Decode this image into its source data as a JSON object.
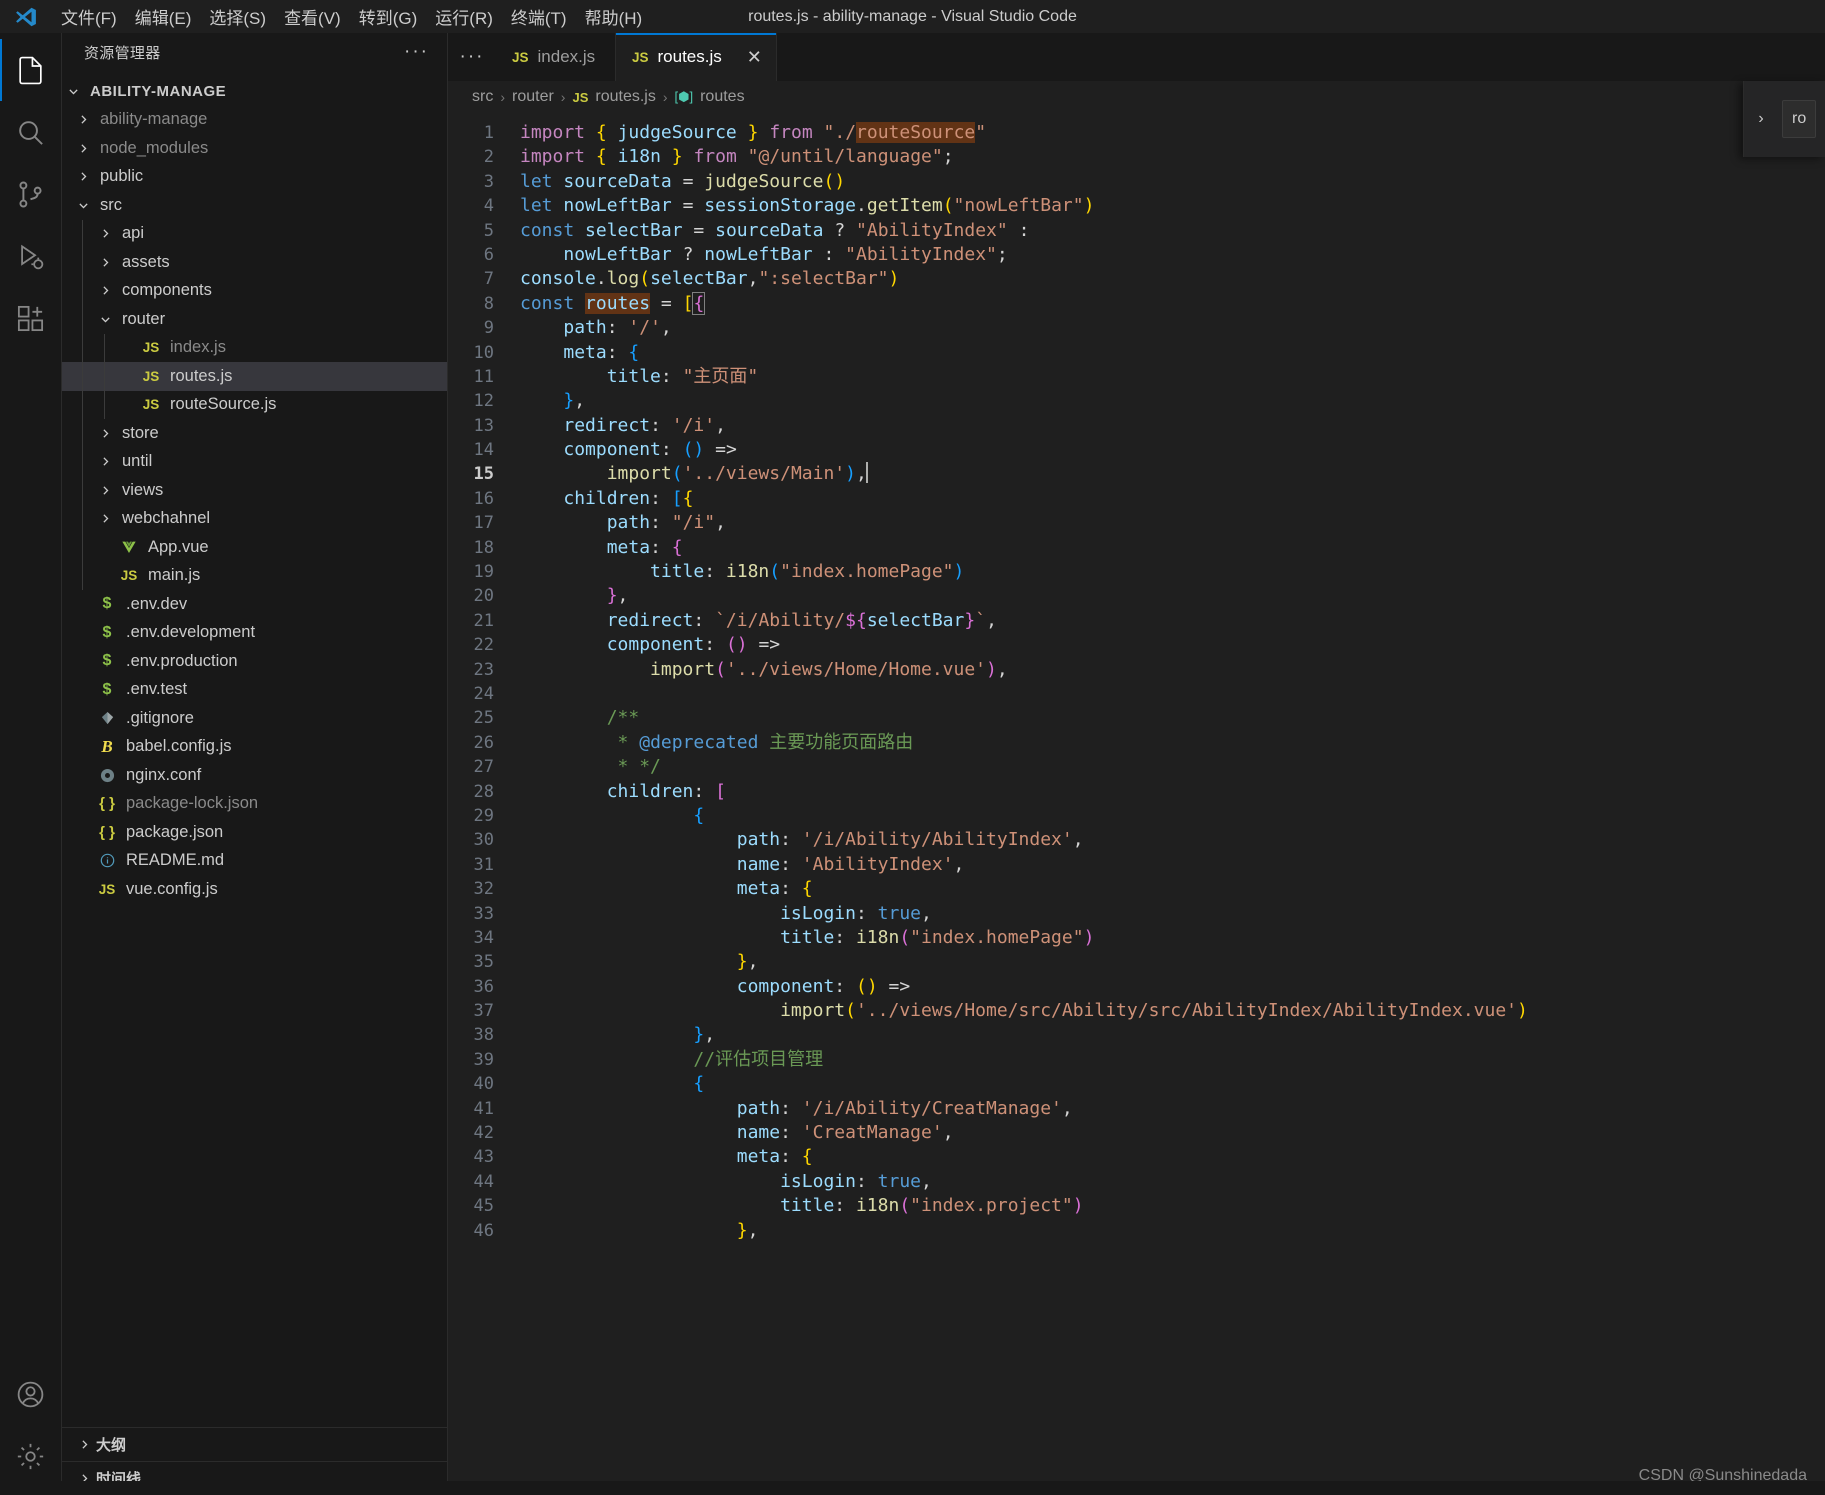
{
  "window": {
    "title": "routes.js - ability-manage - Visual Studio Code",
    "logo_icon": "vscode-logo"
  },
  "menubar": {
    "items": [
      {
        "label": "文件(F)",
        "name": "menu-file"
      },
      {
        "label": "编辑(E)",
        "name": "menu-edit"
      },
      {
        "label": "选择(S)",
        "name": "menu-selection"
      },
      {
        "label": "查看(V)",
        "name": "menu-view"
      },
      {
        "label": "转到(G)",
        "name": "menu-go"
      },
      {
        "label": "运行(R)",
        "name": "menu-run"
      },
      {
        "label": "终端(T)",
        "name": "menu-terminal"
      },
      {
        "label": "帮助(H)",
        "name": "menu-help"
      }
    ]
  },
  "activitybar": {
    "items": [
      {
        "icon": "files-explorer-icon",
        "active": true
      },
      {
        "icon": "search-icon",
        "active": false
      },
      {
        "icon": "source-control-icon",
        "active": false
      },
      {
        "icon": "run-and-debug-icon",
        "active": false
      },
      {
        "icon": "extensions-icon",
        "active": false
      }
    ],
    "bottom": [
      {
        "icon": "accounts-icon"
      },
      {
        "icon": "settings-gear-icon"
      }
    ]
  },
  "sidebar": {
    "header_title": "资源管理器",
    "more_actions": "···",
    "root_label": "ABILITY-MANAGE",
    "tree": [
      {
        "label": "ability-manage",
        "depth": 1,
        "type": "folder",
        "expanded": false,
        "dim": true
      },
      {
        "label": "node_modules",
        "depth": 1,
        "type": "folder",
        "expanded": false,
        "dim": true
      },
      {
        "label": "public",
        "depth": 1,
        "type": "folder",
        "expanded": false,
        "dim": false
      },
      {
        "label": "src",
        "depth": 1,
        "type": "folder",
        "expanded": true,
        "dim": false
      },
      {
        "label": "api",
        "depth": 2,
        "type": "folder",
        "expanded": false,
        "dim": false
      },
      {
        "label": "assets",
        "depth": 2,
        "type": "folder",
        "expanded": false,
        "dim": false
      },
      {
        "label": "components",
        "depth": 2,
        "type": "folder",
        "expanded": false,
        "dim": false
      },
      {
        "label": "router",
        "depth": 2,
        "type": "folder",
        "expanded": true,
        "dim": false
      },
      {
        "label": "index.js",
        "depth": 3,
        "type": "js",
        "dim": true
      },
      {
        "label": "routes.js",
        "depth": 3,
        "type": "js",
        "selected": true,
        "dim": false
      },
      {
        "label": "routeSource.js",
        "depth": 3,
        "type": "js",
        "dim": false
      },
      {
        "label": "store",
        "depth": 2,
        "type": "folder",
        "expanded": false,
        "dim": false
      },
      {
        "label": "until",
        "depth": 2,
        "type": "folder",
        "expanded": false,
        "dim": false
      },
      {
        "label": "views",
        "depth": 2,
        "type": "folder",
        "expanded": false,
        "dim": false
      },
      {
        "label": "webchahnel",
        "depth": 2,
        "type": "folder",
        "expanded": false,
        "dim": false
      },
      {
        "label": "App.vue",
        "depth": 2,
        "type": "vue",
        "dim": false
      },
      {
        "label": "main.js",
        "depth": 2,
        "type": "js",
        "dim": false
      },
      {
        "label": ".env.dev",
        "depth": 1,
        "type": "env",
        "dim": false
      },
      {
        "label": ".env.development",
        "depth": 1,
        "type": "env",
        "dim": false
      },
      {
        "label": ".env.production",
        "depth": 1,
        "type": "env",
        "dim": false
      },
      {
        "label": ".env.test",
        "depth": 1,
        "type": "env",
        "dim": false
      },
      {
        "label": ".gitignore",
        "depth": 1,
        "type": "git",
        "dim": false
      },
      {
        "label": "babel.config.js",
        "depth": 1,
        "type": "babel",
        "dim": false
      },
      {
        "label": "nginx.conf",
        "depth": 1,
        "type": "conf",
        "dim": false
      },
      {
        "label": "package-lock.json",
        "depth": 1,
        "type": "json",
        "dim": true
      },
      {
        "label": "package.json",
        "depth": 1,
        "type": "json",
        "dim": false
      },
      {
        "label": "README.md",
        "depth": 1,
        "type": "md",
        "dim": false
      },
      {
        "label": "vue.config.js",
        "depth": 1,
        "type": "js",
        "dim": false
      }
    ],
    "sections": [
      {
        "label": "大纲",
        "name": "sidebar-section-outline"
      },
      {
        "label": "时间线",
        "name": "sidebar-section-timeline"
      }
    ]
  },
  "tabs": {
    "overflow_label": "···",
    "items": [
      {
        "label": "index.js",
        "badge": "JS",
        "active": false,
        "closable": false
      },
      {
        "label": "routes.js",
        "badge": "JS",
        "active": true,
        "closable": true,
        "close_glyph": "✕"
      }
    ]
  },
  "breadcrumb": {
    "separator": "›",
    "items": [
      {
        "label": "src",
        "kind": "folder"
      },
      {
        "label": "router",
        "kind": "folder"
      },
      {
        "label": "routes.js",
        "kind": "js"
      },
      {
        "label": "routes",
        "kind": "symbol"
      }
    ]
  },
  "right_peek": {
    "chevron": "›",
    "tab_label": "ro"
  },
  "watermark": "CSDN @Sunshinedada",
  "editor": {
    "language": "javascript",
    "cursor_line": 15,
    "highlighted_word": "routes",
    "first_line": 1,
    "last_line": 46,
    "lines": [
      {
        "n": 1,
        "html": "<span class=\"kw\">import</span> <span class=\"b1\">{</span> <span class=\"var\">judgeSource</span> <span class=\"b1\">}</span> <span class=\"kw\">from</span> <span class=\"str\">\"./</span><span class=\"str hl\">routeSource</span><span class=\"str\">\"</span>"
      },
      {
        "n": 2,
        "html": "<span class=\"kw\">import</span> <span class=\"b1\">{</span> <span class=\"var\">i18n</span> <span class=\"b1\">}</span> <span class=\"kw\">from</span> <span class=\"str\">\"@/until/language\"</span><span class=\"op\">;</span>"
      },
      {
        "n": 3,
        "html": "<span class=\"kw2\">let</span> <span class=\"var\">sourceData</span> <span class=\"op\">=</span> <span class=\"fn\">judgeSource</span><span class=\"b1\">()</span>"
      },
      {
        "n": 4,
        "html": "<span class=\"kw2\">let</span> <span class=\"var\">nowLeftBar</span> <span class=\"op\">=</span> <span class=\"var\">sessionStorage</span><span class=\"op\">.</span><span class=\"fn\">getItem</span><span class=\"b1\">(</span><span class=\"str\">\"nowLeftBar\"</span><span class=\"b1\">)</span>"
      },
      {
        "n": 5,
        "html": "<span class=\"kw2\">const</span> <span class=\"var\">selectBar</span> <span class=\"op\">=</span> <span class=\"var\">sourceData</span> <span class=\"op\">?</span> <span class=\"str\">\"AbilityIndex\"</span> <span class=\"op\">:</span>"
      },
      {
        "n": 6,
        "html": "    <span class=\"var\">nowLeftBar</span> <span class=\"op\">?</span> <span class=\"var\">nowLeftBar</span> <span class=\"op\">:</span> <span class=\"str\">\"AbilityIndex\"</span><span class=\"op\">;</span>"
      },
      {
        "n": 7,
        "html": "<span class=\"var\">console</span><span class=\"op\">.</span><span class=\"fn\">log</span><span class=\"b1\">(</span><span class=\"var\">selectBar</span><span class=\"op\">,</span><span class=\"str\">\":selectBar\"</span><span class=\"b1\">)</span>"
      },
      {
        "n": 8,
        "html": "<span class=\"kw2\">const</span> <span class=\"var hl\">routes</span> <span class=\"op\">=</span> <span class=\"b1\">[</span><span class=\"b2 hl-box\">{</span>"
      },
      {
        "n": 9,
        "html": "    <span class=\"var\">path</span><span class=\"op\">:</span> <span class=\"str\">'/'</span><span class=\"op\">,</span>"
      },
      {
        "n": 10,
        "html": "    <span class=\"var\">meta</span><span class=\"op\">:</span> <span class=\"b3\">{</span>"
      },
      {
        "n": 11,
        "html": "        <span class=\"var\">title</span><span class=\"op\">:</span> <span class=\"str\">\"主页面\"</span>"
      },
      {
        "n": 12,
        "html": "    <span class=\"b3\">}</span><span class=\"op\">,</span>"
      },
      {
        "n": 13,
        "html": "    <span class=\"var\">redirect</span><span class=\"op\">:</span> <span class=\"str\">'/i'</span><span class=\"op\">,</span>"
      },
      {
        "n": 14,
        "html": "    <span class=\"var\">component</span><span class=\"op\">:</span> <span class=\"b3\">()</span> <span class=\"op\">=&gt;</span>"
      },
      {
        "n": 15,
        "html": "        <span class=\"fn\">import</span><span class=\"b3\">(</span><span class=\"str\">'../views/Main'</span><span class=\"b3\">)</span><span class=\"op\">,</span><span class=\"cursor-bar\"></span>"
      },
      {
        "n": 16,
        "html": "    <span class=\"var\">children</span><span class=\"op\">:</span> <span class=\"b3\">[</span><span class=\"b1\">{</span>"
      },
      {
        "n": 17,
        "html": "        <span class=\"var\">path</span><span class=\"op\">:</span> <span class=\"str\">\"/i\"</span><span class=\"op\">,</span>"
      },
      {
        "n": 18,
        "html": "        <span class=\"var\">meta</span><span class=\"op\">:</span> <span class=\"b2\">{</span>"
      },
      {
        "n": 19,
        "html": "            <span class=\"var\">title</span><span class=\"op\">:</span> <span class=\"fn\">i18n</span><span class=\"b3\">(</span><span class=\"str\">\"index.homePage\"</span><span class=\"b3\">)</span>"
      },
      {
        "n": 20,
        "html": "        <span class=\"b2\">}</span><span class=\"op\">,</span>"
      },
      {
        "n": 21,
        "html": "        <span class=\"var\">redirect</span><span class=\"op\">:</span> <span class=\"str\">`/i/Ability/</span><span class=\"b2\">${</span><span class=\"var\">selectBar</span><span class=\"b2\">}</span><span class=\"str\">`</span><span class=\"op\">,</span>"
      },
      {
        "n": 22,
        "html": "        <span class=\"var\">component</span><span class=\"op\">:</span> <span class=\"b2\">()</span> <span class=\"op\">=&gt;</span>"
      },
      {
        "n": 23,
        "html": "            <span class=\"fn\">import</span><span class=\"b2\">(</span><span class=\"str\">'../views/Home/Home.vue'</span><span class=\"b2\">)</span><span class=\"op\">,</span>"
      },
      {
        "n": 24,
        "html": ""
      },
      {
        "n": 25,
        "html": "        <span class=\"cmt\">/**</span>"
      },
      {
        "n": 26,
        "html": "         <span class=\"cmt\">* </span><span class=\"cmt-tag\">@deprecated</span><span class=\"cmt\"> 主要功能页面路由</span>"
      },
      {
        "n": 27,
        "html": "         <span class=\"cmt\">* */</span>"
      },
      {
        "n": 28,
        "html": "        <span class=\"var\">children</span><span class=\"op\">:</span> <span class=\"b2\">[</span>"
      },
      {
        "n": 29,
        "html": "                <span class=\"b3\">{</span>"
      },
      {
        "n": 30,
        "html": "                    <span class=\"var\">path</span><span class=\"op\">:</span> <span class=\"str\">'/i/Ability/AbilityIndex'</span><span class=\"op\">,</span>"
      },
      {
        "n": 31,
        "html": "                    <span class=\"var\">name</span><span class=\"op\">:</span> <span class=\"str\">'AbilityIndex'</span><span class=\"op\">,</span>"
      },
      {
        "n": 32,
        "html": "                    <span class=\"var\">meta</span><span class=\"op\">:</span> <span class=\"b1\">{</span>"
      },
      {
        "n": 33,
        "html": "                        <span class=\"var\">isLogin</span><span class=\"op\">:</span> <span class=\"kw2\">true</span><span class=\"op\">,</span>"
      },
      {
        "n": 34,
        "html": "                        <span class=\"var\">title</span><span class=\"op\">:</span> <span class=\"fn\">i18n</span><span class=\"b2\">(</span><span class=\"str\">\"index.homePage\"</span><span class=\"b2\">)</span>"
      },
      {
        "n": 35,
        "html": "                    <span class=\"b1\">}</span><span class=\"op\">,</span>"
      },
      {
        "n": 36,
        "html": "                    <span class=\"var\">component</span><span class=\"op\">:</span> <span class=\"b1\">()</span> <span class=\"op\">=&gt;</span>"
      },
      {
        "n": 37,
        "html": "                        <span class=\"fn\">import</span><span class=\"b1\">(</span><span class=\"str\">'../views/Home/src/Ability/src/AbilityIndex/AbilityIndex.vue'</span><span class=\"b1\">)</span>"
      },
      {
        "n": 38,
        "html": "                <span class=\"b3\">}</span><span class=\"op\">,</span>"
      },
      {
        "n": 39,
        "html": "                <span class=\"cmt\">//评估项目管理</span>"
      },
      {
        "n": 40,
        "html": "                <span class=\"b3\">{</span>"
      },
      {
        "n": 41,
        "html": "                    <span class=\"var\">path</span><span class=\"op\">:</span> <span class=\"str\">'/i/Ability/CreatManage'</span><span class=\"op\">,</span>"
      },
      {
        "n": 42,
        "html": "                    <span class=\"var\">name</span><span class=\"op\">:</span> <span class=\"str\">'CreatManage'</span><span class=\"op\">,</span>"
      },
      {
        "n": 43,
        "html": "                    <span class=\"var\">meta</span><span class=\"op\">:</span> <span class=\"b1\">{</span>"
      },
      {
        "n": 44,
        "html": "                        <span class=\"var\">isLogin</span><span class=\"op\">:</span> <span class=\"kw2\">true</span><span class=\"op\">,</span>"
      },
      {
        "n": 45,
        "html": "                        <span class=\"var\">title</span><span class=\"op\">:</span> <span class=\"fn\">i18n</span><span class=\"b2\">(</span><span class=\"str\">\"index.project\"</span><span class=\"b2\">)</span>"
      },
      {
        "n": 46,
        "html": "                    <span class=\"b1\">}</span><span class=\"op\">,</span>"
      }
    ]
  },
  "colors": {
    "accent": "#0078d4",
    "editor_bg": "#1f1f1f",
    "sidebar_bg": "#181818",
    "selection": "#37373d",
    "highlight": "#623315"
  }
}
